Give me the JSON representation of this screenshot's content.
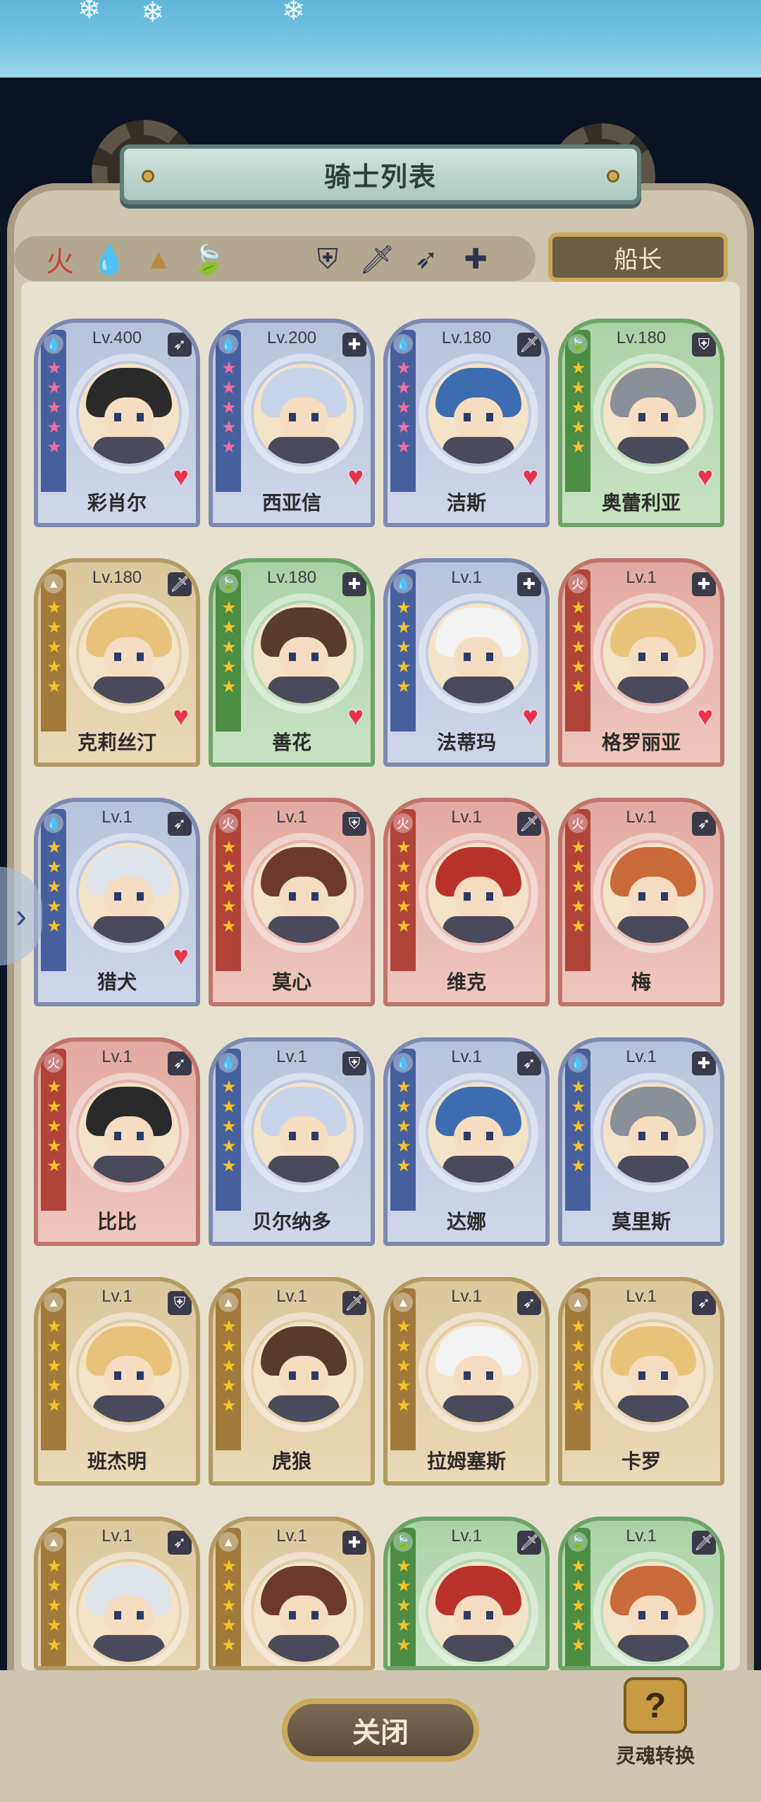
{
  "header": {
    "title": "骑士列表"
  },
  "filters": {
    "elements": [
      {
        "icon": "fire-element-icon",
        "glyph": "火",
        "color": "#c0453a"
      },
      {
        "icon": "water-element-icon",
        "glyph": "💧",
        "color": "#3c66b4"
      },
      {
        "icon": "earth-element-icon",
        "glyph": "▲",
        "color": "#b88a3e"
      },
      {
        "icon": "grass-element-icon",
        "glyph": "🍃",
        "color": "#4f9a45"
      }
    ],
    "classes": [
      {
        "icon": "shield-class-icon",
        "glyph": "⛨"
      },
      {
        "icon": "sword-class-icon",
        "glyph": "🗡"
      },
      {
        "icon": "bow-class-icon",
        "glyph": "➶"
      },
      {
        "icon": "support-class-icon",
        "glyph": "✚"
      }
    ],
    "captain_label": "船长"
  },
  "knights": [
    {
      "name": "彩肖尔",
      "level": "Lv.400",
      "element": "w",
      "class": "bow",
      "stars": "★★★★★",
      "pink": true,
      "heart": true
    },
    {
      "name": "西亚信",
      "level": "Lv.200",
      "element": "w",
      "class": "support",
      "stars": "★★★★★",
      "pink": true,
      "heart": true
    },
    {
      "name": "洁斯",
      "level": "Lv.180",
      "element": "w",
      "class": "sword",
      "stars": "★★★★★",
      "pink": true,
      "heart": true
    },
    {
      "name": "奥蕾利亚",
      "level": "Lv.180",
      "element": "g",
      "class": "shield",
      "stars": "★★★★★",
      "pink": false,
      "heart": true
    },
    {
      "name": "克莉丝汀",
      "level": "Lv.180",
      "element": "e",
      "class": "sword",
      "stars": "★★★★★",
      "pink": false,
      "heart": true
    },
    {
      "name": "善花",
      "level": "Lv.180",
      "element": "g",
      "class": "support",
      "stars": "★★★★★",
      "pink": false,
      "heart": true
    },
    {
      "name": "法蒂玛",
      "level": "Lv.1",
      "element": "w",
      "class": "support",
      "stars": "★★★★★",
      "pink": false,
      "heart": true
    },
    {
      "name": "格罗丽亚",
      "level": "Lv.1",
      "element": "f",
      "class": "support",
      "stars": "★★★★★",
      "pink": false,
      "heart": true
    },
    {
      "name": "猎犬",
      "level": "Lv.1",
      "element": "w",
      "class": "bow",
      "stars": "★★★★★",
      "pink": false,
      "heart": true
    },
    {
      "name": "莫心",
      "level": "Lv.1",
      "element": "f",
      "class": "shield",
      "stars": "★★★★★",
      "pink": false,
      "heart": false
    },
    {
      "name": "维克",
      "level": "Lv.1",
      "element": "f",
      "class": "sword",
      "stars": "★★★★★",
      "pink": false,
      "heart": false
    },
    {
      "name": "梅",
      "level": "Lv.1",
      "element": "f",
      "class": "bow",
      "stars": "★★★★★",
      "pink": false,
      "heart": false
    },
    {
      "name": "比比",
      "level": "Lv.1",
      "element": "f",
      "class": "bow",
      "stars": "★★★★★",
      "pink": false,
      "heart": false
    },
    {
      "name": "贝尔纳多",
      "level": "Lv.1",
      "element": "w",
      "class": "shield",
      "stars": "★★★★★",
      "pink": false,
      "heart": false
    },
    {
      "name": "达娜",
      "level": "Lv.1",
      "element": "w",
      "class": "bow",
      "stars": "★★★★★",
      "pink": false,
      "heart": false
    },
    {
      "name": "莫里斯",
      "level": "Lv.1",
      "element": "w",
      "class": "support",
      "stars": "★★★★★",
      "pink": false,
      "heart": false
    },
    {
      "name": "班杰明",
      "level": "Lv.1",
      "element": "e",
      "class": "shield",
      "stars": "★★★★★",
      "pink": false,
      "heart": false
    },
    {
      "name": "虎狼",
      "level": "Lv.1",
      "element": "e",
      "class": "sword",
      "stars": "★★★★★",
      "pink": false,
      "heart": false
    },
    {
      "name": "拉姆塞斯",
      "level": "Lv.1",
      "element": "e",
      "class": "bow",
      "stars": "★★★★★",
      "pink": false,
      "heart": false
    },
    {
      "name": "卡罗",
      "level": "Lv.1",
      "element": "e",
      "class": "bow",
      "stars": "★★★★★",
      "pink": false,
      "heart": false
    },
    {
      "name": "",
      "level": "Lv.1",
      "element": "e",
      "class": "bow",
      "stars": "★★★★★",
      "pink": false,
      "heart": false
    },
    {
      "name": "",
      "level": "Lv.1",
      "element": "e",
      "class": "support",
      "stars": "★★★★★",
      "pink": false,
      "heart": false
    },
    {
      "name": "",
      "level": "Lv.1",
      "element": "g",
      "class": "sword",
      "stars": "★★★★★",
      "pink": false,
      "heart": false
    },
    {
      "name": "",
      "level": "Lv.1",
      "element": "g",
      "class": "sword",
      "stars": "★★★★★",
      "pink": false,
      "heart": false
    }
  ],
  "class_glyphs": {
    "bow": "➶",
    "support": "✚",
    "sword": "🗡",
    "shield": "⛨"
  },
  "element_glyphs": {
    "w": "💧",
    "f": "火",
    "e": "▲",
    "g": "🍃"
  },
  "footer": {
    "close_label": "关闭",
    "soul_label": "灵魂转换",
    "soul_glyph": "?"
  },
  "side_arrow_glyph": "›"
}
